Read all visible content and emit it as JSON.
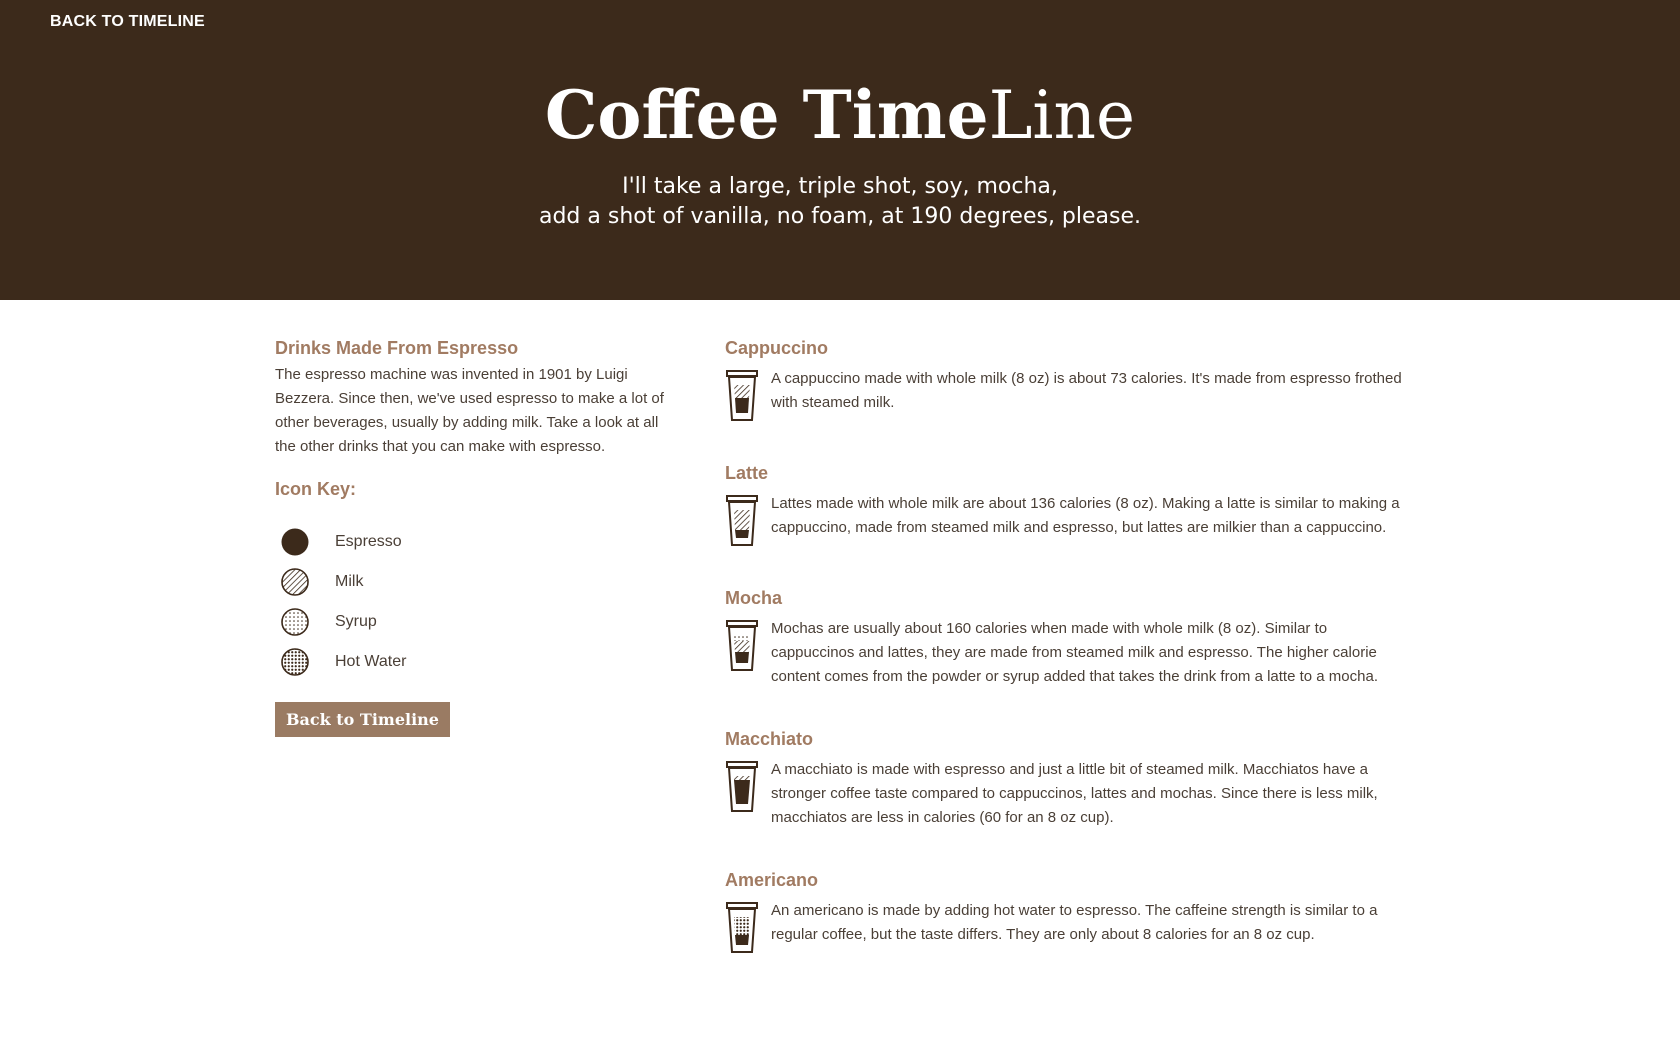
{
  "header": {
    "back_link": "BACK TO TIMELINE",
    "title_bold": "Coffee Time",
    "title_light": "Line",
    "subtitle_line1": "I'll take a large, triple shot, soy, mocha,",
    "subtitle_line2": "add a shot of vanilla, no foam, at 190 degrees, please."
  },
  "sidebar": {
    "heading": "Drinks Made From Espresso",
    "intro": "The espresso machine was invented in 1901 by Luigi Bezzera. Since then, we've used espresso to make a lot of other beverages, usually by adding milk. Take a look at all the other drinks that you can make with espresso.",
    "key_title": "Icon Key:",
    "key": [
      {
        "label": "Espresso",
        "icon": "espresso-icon"
      },
      {
        "label": "Milk",
        "icon": "milk-icon"
      },
      {
        "label": "Syrup",
        "icon": "syrup-icon"
      },
      {
        "label": "Hot Water",
        "icon": "hot-water-icon"
      }
    ],
    "back_button": "Back to Timeline"
  },
  "drinks": [
    {
      "name": "Cappuccino",
      "description": "A cappuccino made with whole milk (8 oz) is about 73 calories. It's made from espresso frothed with steamed milk.",
      "icon": "cappuccino-cup-icon"
    },
    {
      "name": "Latte",
      "description": "Lattes made with whole milk are about 136 calories (8 oz). Making a latte is similar to making a cappuccino, made from steamed milk and espresso, but lattes are milkier than a cappuccino.",
      "icon": "latte-cup-icon"
    },
    {
      "name": "Mocha",
      "description": "Mochas are usually about 160 calories when made with whole milk (8 oz). Similar to cappuccinos and lattes, they are made from steamed milk and espresso. The higher calorie content comes from the powder or syrup added that takes the drink from a latte to a mocha.",
      "icon": "mocha-cup-icon"
    },
    {
      "name": "Macchiato",
      "description": "A macchiato is made with espresso and just a little bit of steamed milk. Macchiatos have a stronger coffee taste compared to cappuccinos, lattes and mochas. Since there is less milk, macchiatos are less in calories (60 for an 8 oz cup).",
      "icon": "macchiato-cup-icon"
    },
    {
      "name": "Americano",
      "description": "An americano is made by adding hot water to espresso. The caffeine strength is similar to a regular coffee, but the taste differs. They are only about 8 calories for an 8 oz cup.",
      "icon": "americano-cup-icon"
    }
  ],
  "colors": {
    "header_bg": "#3c2a1b",
    "accent": "#a17b62",
    "button_bg": "#9a7b63",
    "text": "#4a3f36"
  }
}
